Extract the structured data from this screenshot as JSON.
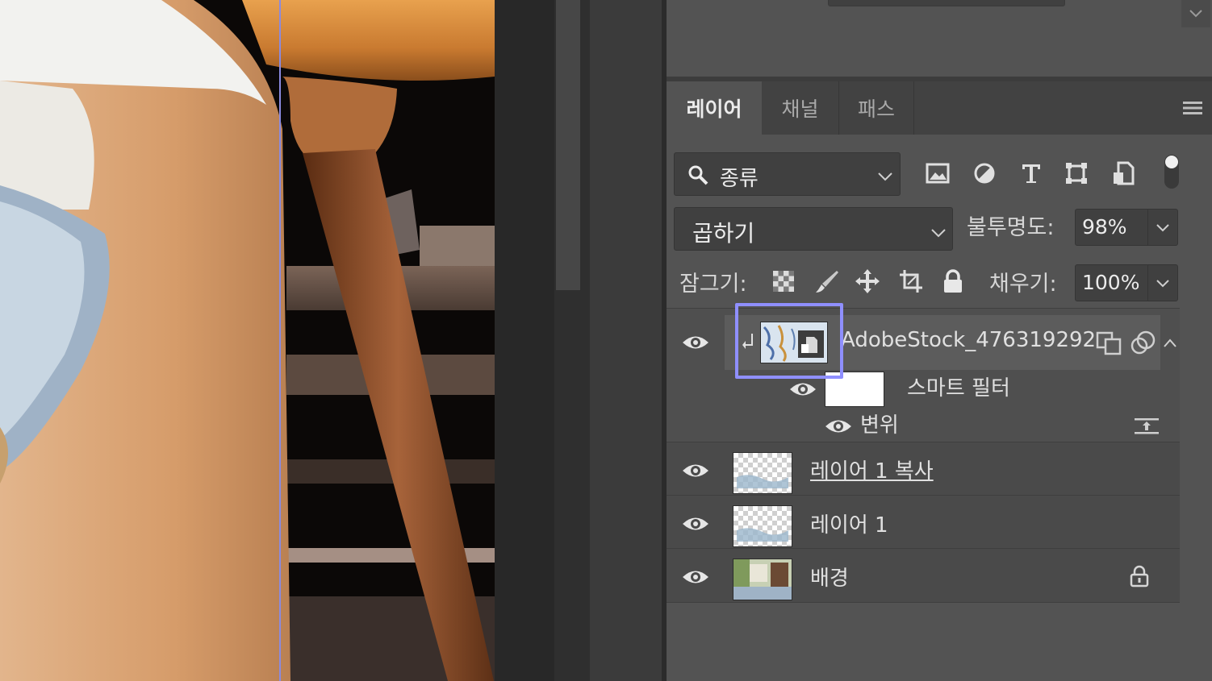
{
  "panel": {
    "tabs": [
      {
        "label": "레이어",
        "active": true
      },
      {
        "label": "채널",
        "active": false
      },
      {
        "label": "패스",
        "active": false
      }
    ],
    "filter": {
      "kind_label": "종류",
      "icons": [
        "image-filter-icon",
        "adjustment-filter-icon",
        "type-filter-icon",
        "shape-filter-icon",
        "smart-object-filter-icon"
      ]
    },
    "blend": {
      "mode": "곱하기",
      "opacity_label": "불투명도:",
      "opacity_value": "98%"
    },
    "lock": {
      "label": "잠그기:",
      "icons": [
        "lock-transparent-pixels-icon",
        "lock-image-pixels-icon",
        "lock-position-icon",
        "lock-artboard-icon",
        "lock-all-icon"
      ],
      "fill_label": "채우기:",
      "fill_value": "100%"
    }
  },
  "layers": [
    {
      "name": "AdobeStock_476319292",
      "type": "smart-object",
      "clipped": true,
      "visible": true,
      "selected": true
    },
    {
      "name": "스마트 필터",
      "type": "smart-filters",
      "visible": true
    },
    {
      "name": "변위",
      "type": "filter",
      "visible": true
    },
    {
      "name": "레이어 1 복사",
      "type": "pixel",
      "visible": true,
      "clipping_base": true
    },
    {
      "name": "레이어 1",
      "type": "pixel",
      "visible": true
    },
    {
      "name": "배경",
      "type": "background",
      "visible": true,
      "locked": true
    }
  ],
  "colors": {
    "panel_bg": "#535353",
    "highlight_box": "#8f8fff",
    "guide": "#8a8ae0"
  }
}
